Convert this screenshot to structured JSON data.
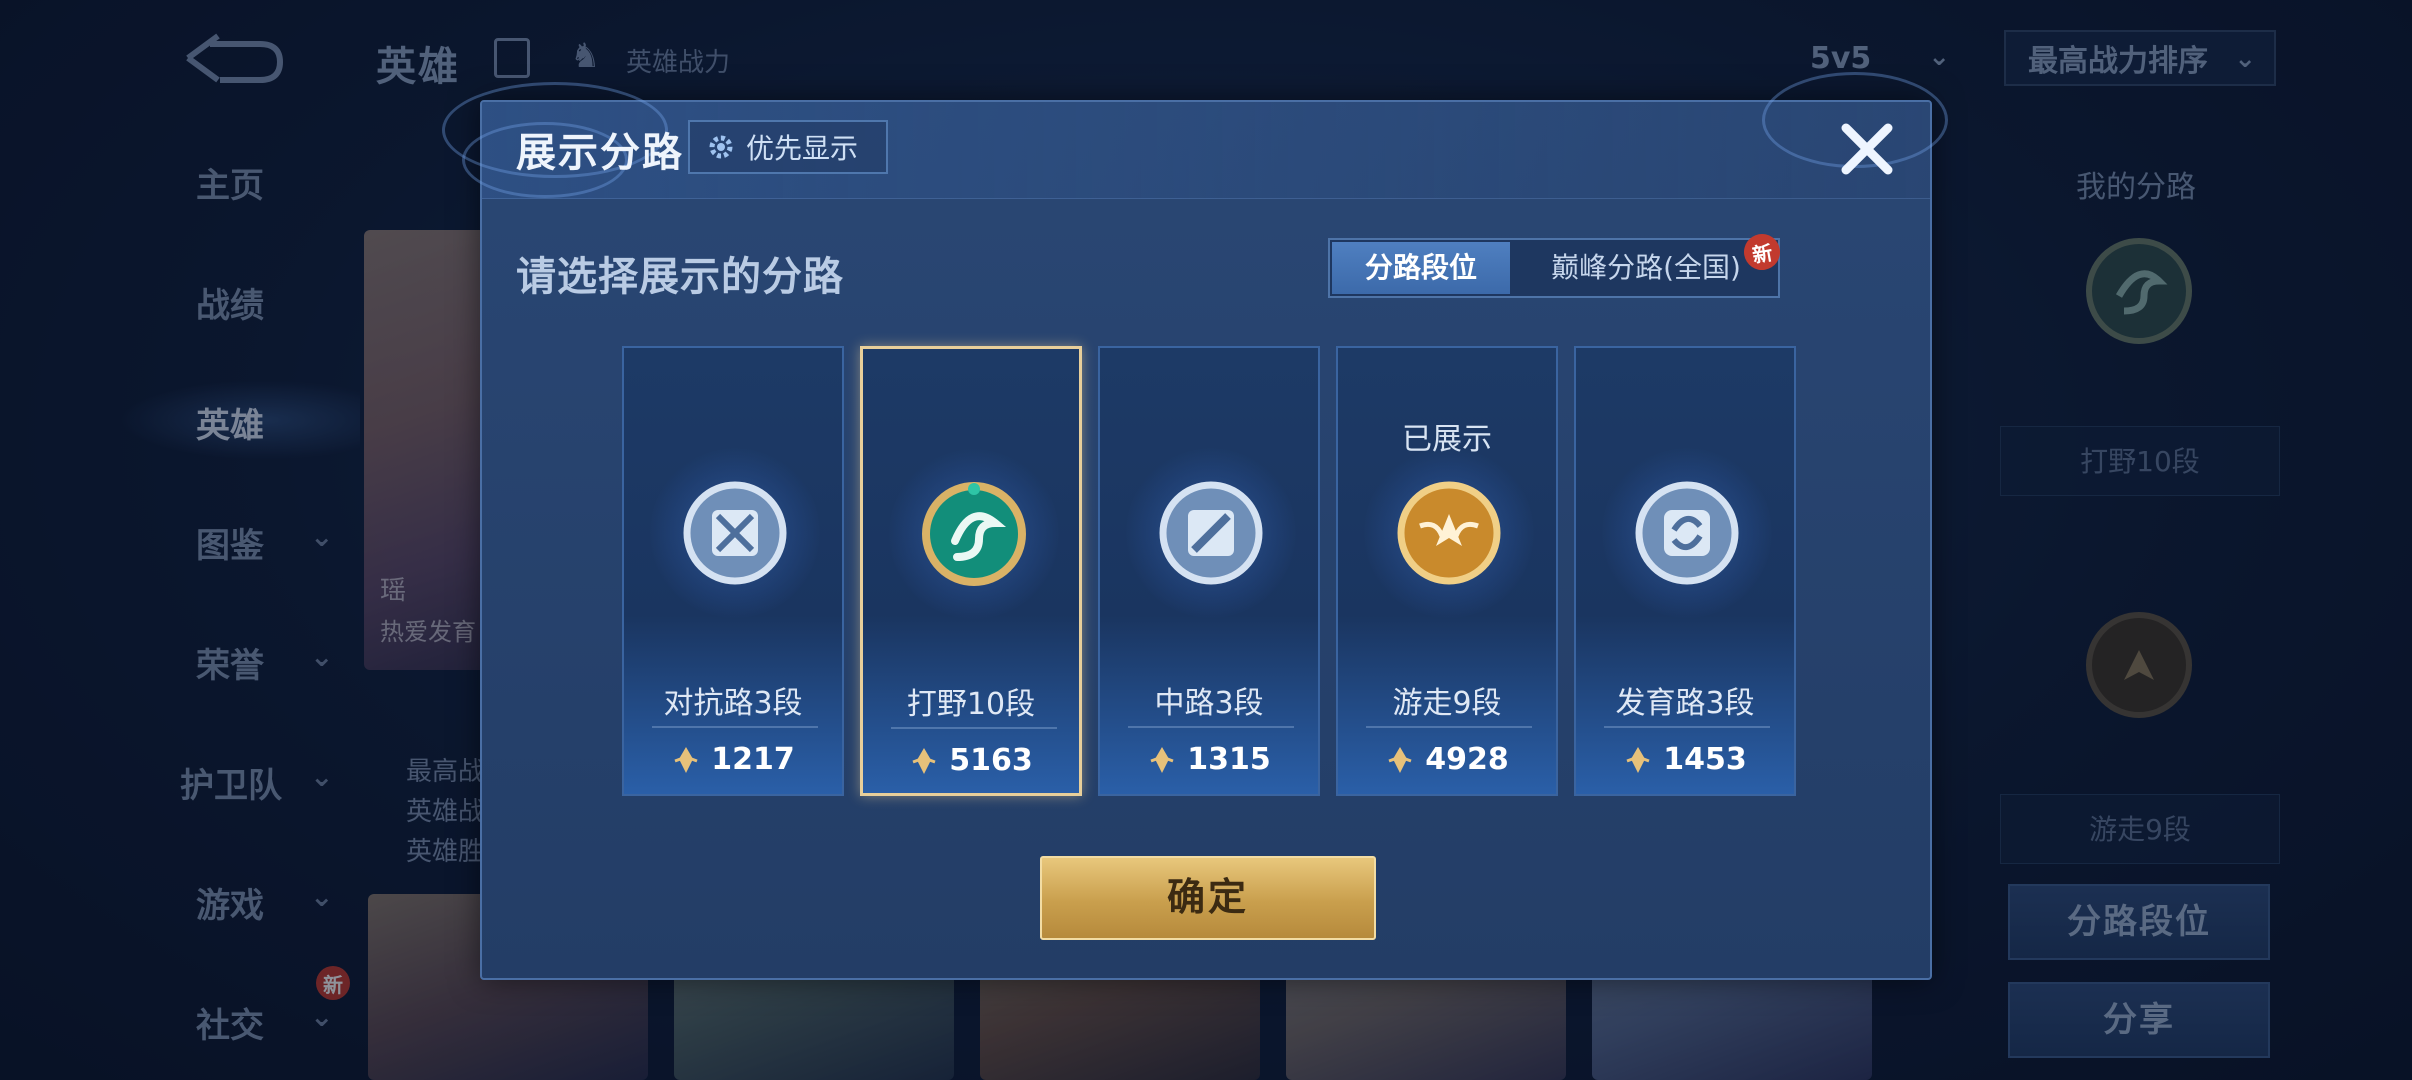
{
  "background": {
    "top_title": "英雄",
    "top_sub": "英雄战力",
    "mode_dropdown": "5v5",
    "sort_dropdown": "最高战力排序",
    "nav": [
      {
        "label": "主页",
        "chevron": false
      },
      {
        "label": "战绩",
        "chevron": false
      },
      {
        "label": "英雄",
        "chevron": false,
        "active": true
      },
      {
        "label": "图鉴",
        "chevron": true
      },
      {
        "label": "荣誉",
        "chevron": true
      },
      {
        "label": "护卫队",
        "chevron": true
      },
      {
        "label": "游戏",
        "chevron": true
      },
      {
        "label": "社交",
        "chevron": true,
        "new": "新"
      }
    ],
    "hero_card": {
      "name": "瑶",
      "sub": "热爱发育"
    },
    "stats": [
      "最高战",
      "英雄战",
      "英雄胜"
    ],
    "right_panel": {
      "title": "我的分路",
      "label_1": "打野10段",
      "label_2": "游走9段",
      "btn_route_rank": "分路段位",
      "btn_share": "分享"
    }
  },
  "modal": {
    "title": "展示分路",
    "priority_label": "优先显示",
    "prompt": "请选择展示的分路",
    "tabs": [
      {
        "label": "分路段位",
        "active": true
      },
      {
        "label": "巅峰分路(全国)",
        "active": false,
        "badge": "新"
      }
    ],
    "routes": [
      {
        "name": "对抗路3段",
        "score": "1217",
        "emblem": "clash-lane-emblem",
        "color": "#b9cde6",
        "selected": false,
        "shown": ""
      },
      {
        "name": "打野10段",
        "score": "5163",
        "emblem": "jungle-dragon-emblem",
        "color": "#1f9e8a",
        "selected": true,
        "shown": ""
      },
      {
        "name": "中路3段",
        "score": "1315",
        "emblem": "mid-lane-emblem",
        "color": "#b9cde6",
        "selected": false,
        "shown": ""
      },
      {
        "name": "游走9段",
        "score": "4928",
        "emblem": "roam-wings-emblem",
        "color": "#d89a3a",
        "selected": false,
        "shown": "已展示"
      },
      {
        "name": "发育路3段",
        "score": "1453",
        "emblem": "farm-lane-emblem",
        "color": "#b9cde6",
        "selected": false,
        "shown": ""
      }
    ],
    "confirm_label": "确定"
  },
  "colors": {
    "accent_gold": "#e8c77c",
    "panel_blue": "#233d66",
    "selected_border": "#e8cf9a"
  }
}
